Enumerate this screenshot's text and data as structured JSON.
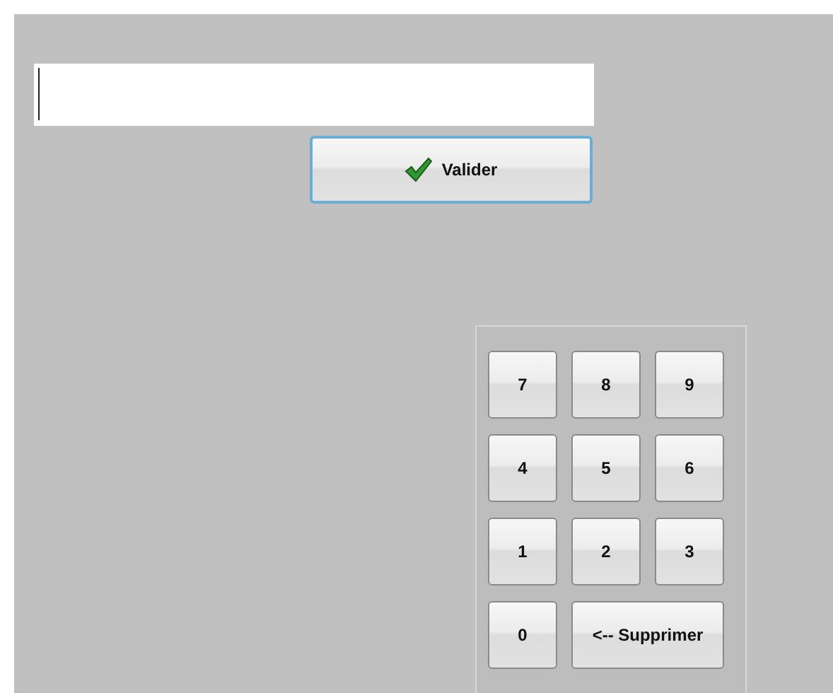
{
  "confirm_button": {
    "label": "Valider"
  },
  "keypad": {
    "keys": [
      {
        "label": "7",
        "kind": "digit"
      },
      {
        "label": "8",
        "kind": "digit"
      },
      {
        "label": "9",
        "kind": "digit"
      },
      {
        "label": "4",
        "kind": "digit"
      },
      {
        "label": "5",
        "kind": "digit"
      },
      {
        "label": "6",
        "kind": "digit"
      },
      {
        "label": "1",
        "kind": "digit"
      },
      {
        "label": "2",
        "kind": "digit"
      },
      {
        "label": "3",
        "kind": "digit"
      },
      {
        "label": "0",
        "kind": "digit"
      },
      {
        "label": "<-- Supprimer",
        "kind": "wide"
      }
    ]
  }
}
